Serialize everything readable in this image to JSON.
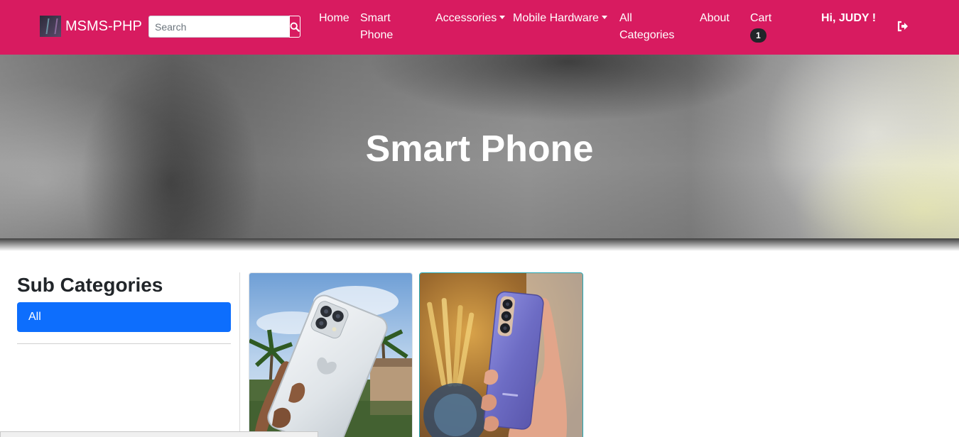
{
  "brand": {
    "name": "MSMS-PHP"
  },
  "search": {
    "placeholder": "Search"
  },
  "nav": {
    "home": "Home",
    "smart_phone": "Smart Phone",
    "accessories": "Accessories",
    "mobile_hardware": "Mobile Hardware",
    "all_categories": "All Categories",
    "about": "About",
    "cart": "Cart",
    "cart_count": "1"
  },
  "user": {
    "greeting": "Hi, JUDY !"
  },
  "hero": {
    "title": "Smart Phone"
  },
  "sidebar": {
    "heading": "Sub Categories",
    "items": [
      {
        "label": "All",
        "active": true
      }
    ]
  },
  "products": [
    {
      "image": "iphone-white-in-hand"
    },
    {
      "image": "samsung-purple-in-hand"
    }
  ],
  "colors": {
    "navbar": "#d81b60",
    "sub_category_active": "#0d6efd",
    "badge": "#212529",
    "card_active_border": "#20a7b5"
  }
}
